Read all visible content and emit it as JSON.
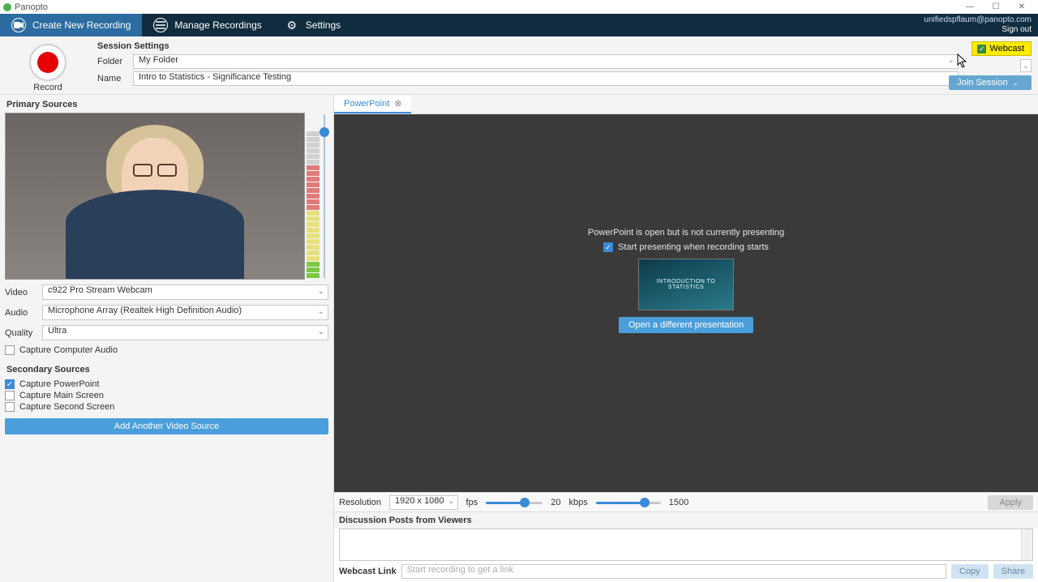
{
  "titlebar": {
    "app_name": "Panopto"
  },
  "nav": {
    "create": "Create New Recording",
    "manage": "Manage Recordings",
    "settings": "Settings",
    "user_email": "unifiedspflaum@panopto.com",
    "signout": "Sign out"
  },
  "session": {
    "heading": "Session Settings",
    "folder_label": "Folder",
    "folder_value": "My Folder",
    "name_label": "Name",
    "name_value": "Intro to Statistics - Significance Testing",
    "webcast_label": "Webcast",
    "join_label": "Join Session"
  },
  "record": {
    "label": "Record"
  },
  "primary": {
    "heading": "Primary Sources",
    "video_label": "Video",
    "video_value": "c922 Pro Stream Webcam",
    "audio_label": "Audio",
    "audio_value": "Microphone Array (Realtek High Definition Audio)",
    "quality_label": "Quality",
    "quality_value": "Ultra",
    "capture_audio": "Capture Computer Audio"
  },
  "secondary": {
    "heading": "Secondary Sources",
    "powerpoint": "Capture PowerPoint",
    "main_screen": "Capture Main Screen",
    "second_screen": "Capture Second Screen",
    "add_source": "Add Another Video Source"
  },
  "powerpoint": {
    "tab_label": "PowerPoint",
    "status": "PowerPoint is open but is not currently presenting",
    "auto_start": "Start presenting when recording starts",
    "slide_title": "INTRODUCTION TO STATISTICS",
    "open_other": "Open a different presentation"
  },
  "encoding": {
    "resolution_label": "Resolution",
    "resolution_value": "1920 x 1080",
    "fps_label": "fps",
    "fps_value": "20",
    "kbps_label": "kbps",
    "kbps_value": "1500",
    "apply": "Apply"
  },
  "discussion": {
    "heading": "Discussion Posts from Viewers"
  },
  "webcast_link": {
    "label": "Webcast Link",
    "placeholder": "Start recording to get a link",
    "copy": "Copy",
    "share": "Share"
  }
}
